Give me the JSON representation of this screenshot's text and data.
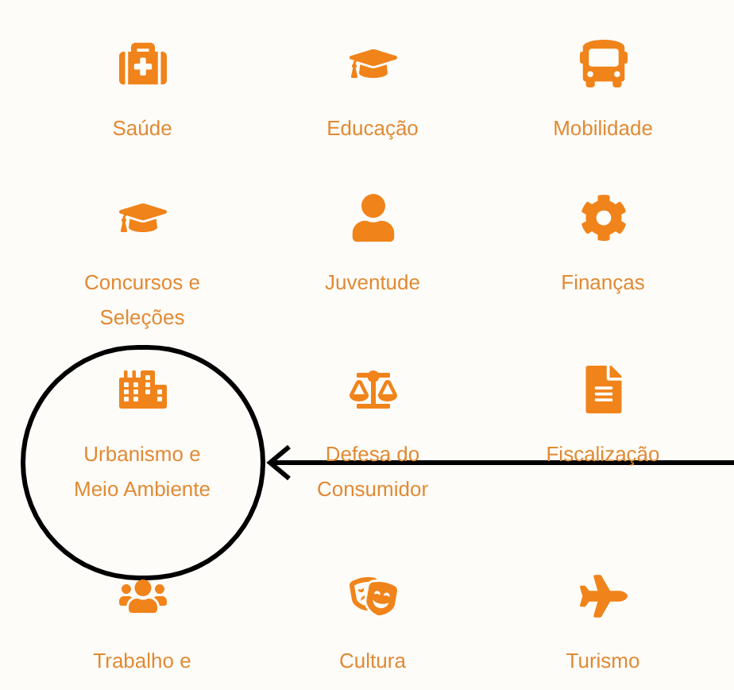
{
  "categories": [
    {
      "label": "Saúde",
      "circled": false
    },
    {
      "label": "Educação",
      "circled": false
    },
    {
      "label": "Mobilidade",
      "circled": false
    },
    {
      "label": "Concursos e Seleções",
      "circled": false
    },
    {
      "label": "Juventude",
      "circled": false
    },
    {
      "label": "Finanças",
      "circled": false
    },
    {
      "label": "Urbanismo e Meio Ambiente",
      "circled": true
    },
    {
      "label": "Defesa do Consumidor",
      "circled": false
    },
    {
      "label": "Fiscalização",
      "circled": false
    },
    {
      "label": "Trabalho e",
      "circled": false
    },
    {
      "label": "Cultura",
      "circled": false
    },
    {
      "label": "Turismo",
      "circled": false
    }
  ]
}
